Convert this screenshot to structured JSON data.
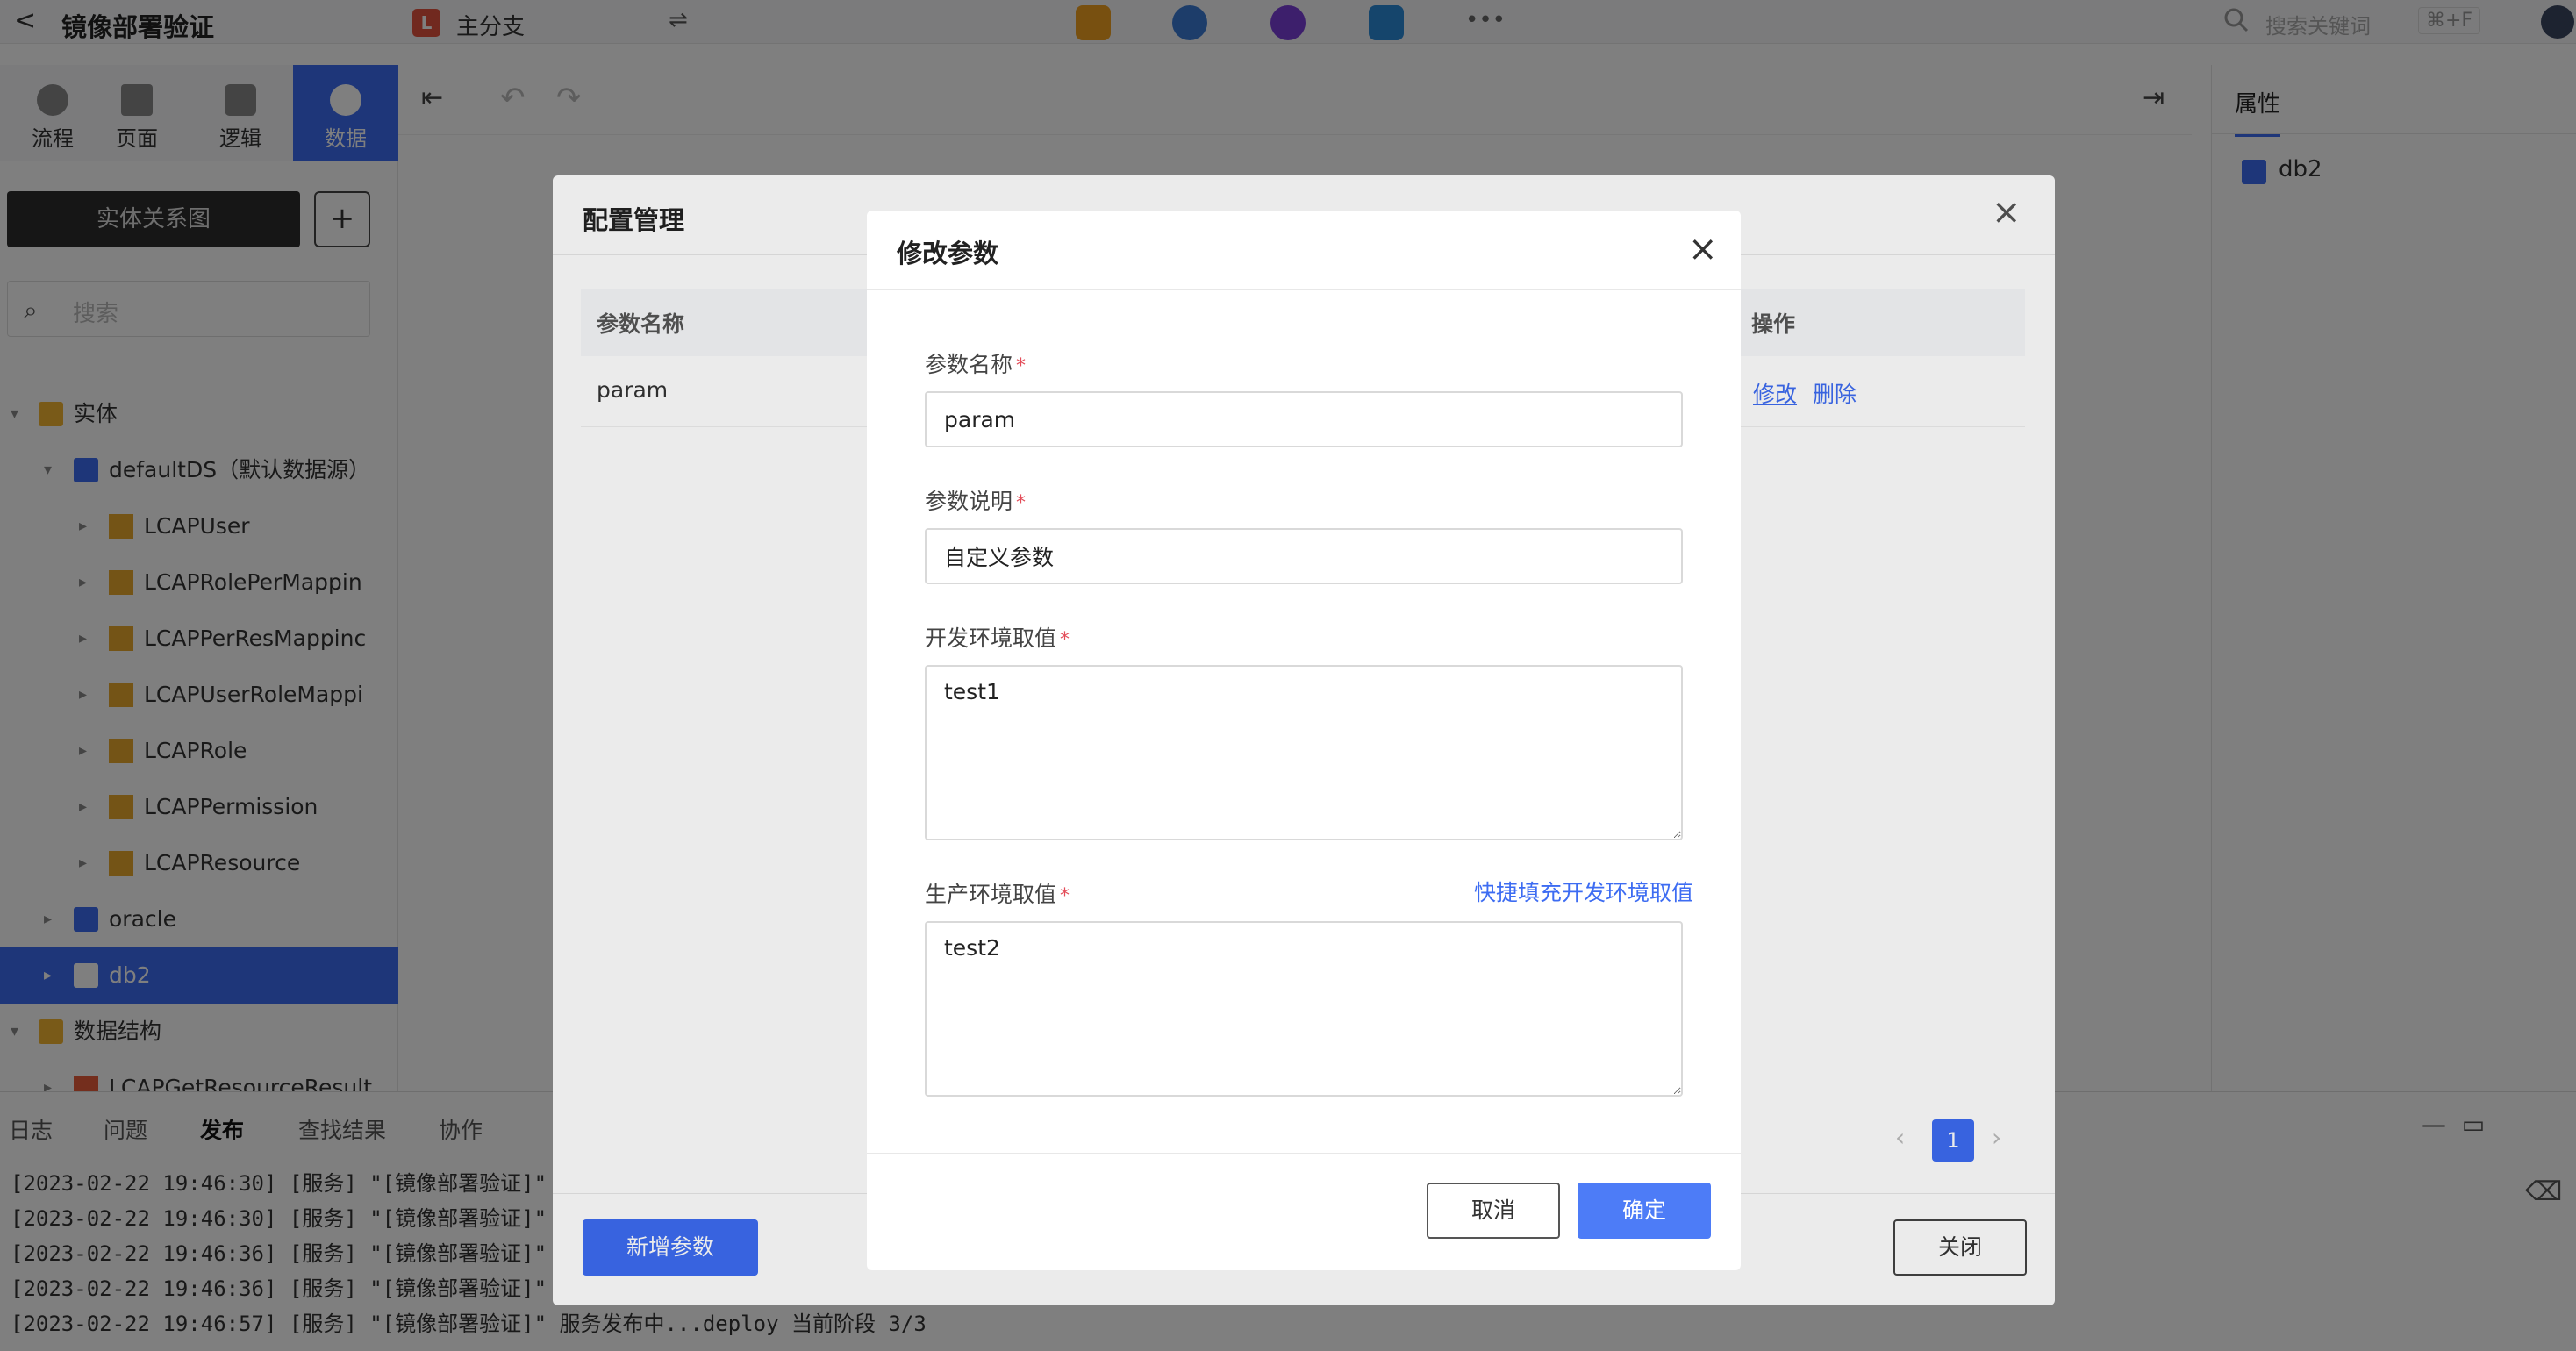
{
  "topbar": {
    "back_icon": "<",
    "title": "镜像部署验证",
    "branch_icon_letter": "L",
    "branch": "主分支",
    "swap_icon": "⇌",
    "search_placeholder": "搜索关键词",
    "search_shortcut": "⌘+F",
    "more_icon": "•••"
  },
  "left_tabs": [
    {
      "label": "流程"
    },
    {
      "label": "页面"
    },
    {
      "label": "逻辑"
    },
    {
      "label": "数据"
    }
  ],
  "sidebar": {
    "er_button": "实体关系图",
    "add_button": "+",
    "search_placeholder": "搜索",
    "tree": [
      {
        "label": "实体"
      },
      {
        "label": "defaultDS（默认数据源）"
      },
      {
        "label": "LCAPUser"
      },
      {
        "label": "LCAPRolePerMappin"
      },
      {
        "label": "LCAPPerResMappinc"
      },
      {
        "label": "LCAPUserRoleMappi"
      },
      {
        "label": "LCAPRole"
      },
      {
        "label": "LCAPPermission"
      },
      {
        "label": "LCAPResource"
      },
      {
        "label": "oracle"
      },
      {
        "label": "db2"
      },
      {
        "label": "数据结构"
      },
      {
        "label": "LCAPGetResourceResult"
      }
    ]
  },
  "properties": {
    "tab": "属性",
    "item": "db2"
  },
  "bottom": {
    "tabs": [
      "日志",
      "问题",
      "发布",
      "查找结果",
      "协作"
    ],
    "logs": [
      "[2023-02-22 19:46:30] [服务] \"[镜像部署验证]\"",
      "[2023-02-22 19:46:30] [服务] \"[镜像部署验证]\"",
      "[2023-02-22 19:46:36] [服务] \"[镜像部署验证]\"",
      "[2023-02-22 19:46:36] [服务] \"[镜像部署验证]\"",
      "[2023-02-22 19:46:57] [服务] \"[镜像部署验证]\" 服务发布中...deploy 当前阶段 3/3"
    ]
  },
  "config_modal": {
    "title": "配置管理",
    "col_name": "参数名称",
    "col_op": "操作",
    "row_name": "param",
    "row_edit": "修改",
    "row_delete": "删除",
    "page_current": "1",
    "page_prev": "‹",
    "page_next": "›",
    "add_button": "新增参数",
    "close_button": "关闭"
  },
  "edit_modal": {
    "title": "修改参数",
    "close_icon": "×",
    "required_mark": "*",
    "name_label": "参数名称",
    "name_value": "param",
    "desc_label": "参数说明",
    "desc_value": "自定义参数",
    "dev_label": "开发环境取值",
    "dev_value": "test1",
    "prod_label": "生产环境取值",
    "prod_value": "test2",
    "quick_fill": "快捷填充开发环境取值",
    "cancel": "取消",
    "confirm": "确定"
  },
  "colors": {
    "primary": "#3d6cf2",
    "confirm": "#4d7cf7",
    "required": "#e34d59",
    "overlay": "rgba(0,0,0,0.5)"
  }
}
